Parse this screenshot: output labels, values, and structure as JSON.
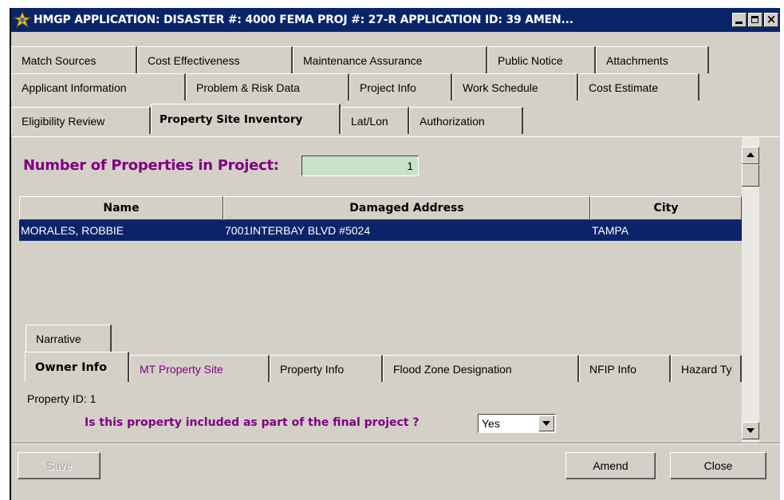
{
  "window": {
    "title": "HMGP APPLICATION:  DISASTER #: 4000   FEMA PROJ #: 27-R   APPLICATION ID: 39   AMEN..."
  },
  "tabs": {
    "row1": [
      "Match Sources",
      "Cost Effectiveness",
      "Maintenance Assurance",
      "Public Notice",
      "Attachments"
    ],
    "row2": [
      "Applicant Information",
      "Problem & Risk Data",
      "Project Info",
      "Work Schedule",
      "Cost Estimate"
    ],
    "row3": [
      "Eligibility Review",
      "Property Site Inventory",
      "Lat/Lon",
      "Authorization"
    ],
    "active": "Property Site Inventory"
  },
  "inventory": {
    "count_label": "Number of Properties in Project:",
    "count_value": "1",
    "columns": [
      "Name",
      "Damaged Address",
      "City"
    ],
    "rows": [
      {
        "name": "MORALES, ROBBIE",
        "address": "7001INTERBAY BLVD #5024",
        "city": "TAMPA"
      }
    ]
  },
  "subtabs": {
    "row1": [
      "Narrative"
    ],
    "row2": [
      "Owner Info",
      "MT Property Site",
      "Property Info",
      "Flood Zone Designation",
      "NFIP Info",
      "Hazard Ty"
    ],
    "active": "Owner Info"
  },
  "owner": {
    "property_id_label": "Property ID:  1",
    "question": "Is this property included as part of the final project ?",
    "answer": "Yes"
  },
  "buttons": {
    "save": "Save",
    "amend": "Amend",
    "close": "Close"
  },
  "colors": {
    "titlebar": "#0a246a",
    "accent_purple": "#800080",
    "selected_row": "#0a246a",
    "count_field": "#c8e2c8"
  }
}
